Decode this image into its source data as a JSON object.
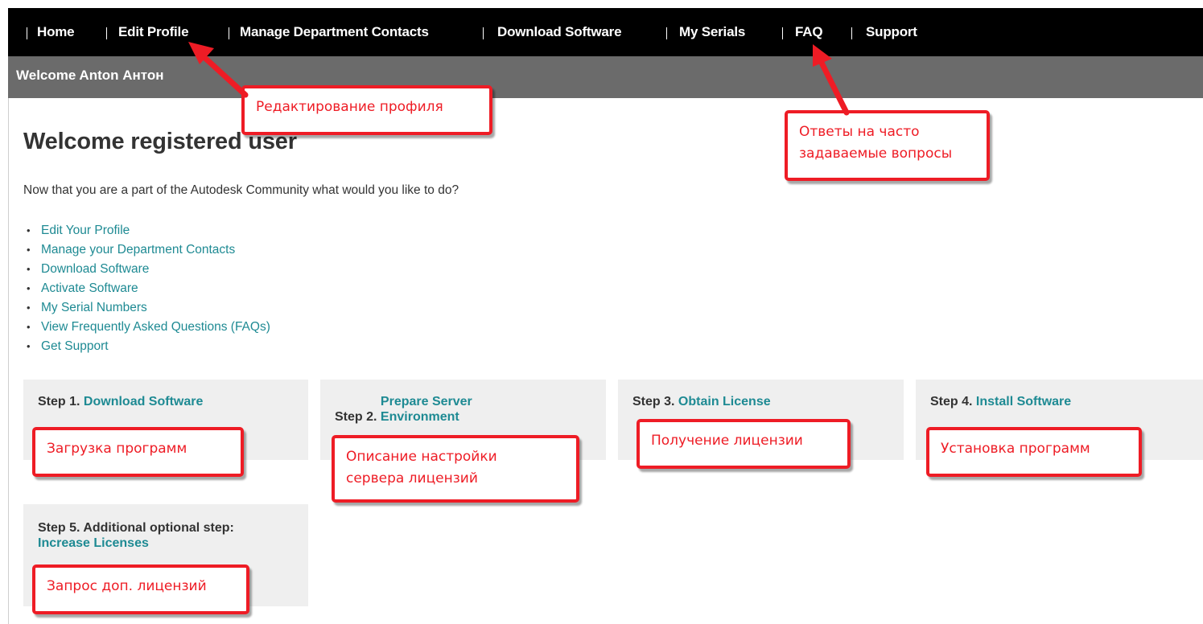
{
  "nav": {
    "items": [
      "Home",
      "Edit Profile",
      "Manage Department Contacts",
      "Download Software",
      "My Serials",
      "FAQ",
      "Support"
    ]
  },
  "welcome_bar": {
    "text": "Welcome Anton Антон"
  },
  "main": {
    "title": "Welcome registered user",
    "intro": "Now that you are a part of the Autodesk Community what would you like to do?",
    "links": [
      "Edit Your Profile",
      "Manage your Department Contacts",
      "Download Software",
      "Activate Software",
      "My Serial Numbers",
      "View Frequently Asked Questions (FAQs)",
      "Get Support"
    ]
  },
  "steps": [
    {
      "label": "Step 1.",
      "link": "Download Software"
    },
    {
      "label": "Step 2.",
      "link": "Prepare Server Environment"
    },
    {
      "label": "Step 3.",
      "link": "Obtain License"
    },
    {
      "label": "Step 4.",
      "link": "Install Software"
    },
    {
      "label": "Step 5. Additional optional step:",
      "link": "Increase Licenses"
    }
  ],
  "annotations": {
    "edit_profile": "Редактирование профиля",
    "faq": [
      "Ответы на часто",
      "задаваемые вопросы"
    ],
    "step1": "Загрузка программ",
    "step2": [
      "Описание настройки",
      "сервера лицензий"
    ],
    "step3": "Получение лицензии",
    "step4": "Установка программ",
    "step5": "Запрос доп. лицензий"
  },
  "colors": {
    "nav_bg": "#000000",
    "welcome_bar_bg": "#6b6b6b",
    "link": "#1e8a93",
    "step_bg": "#efefef",
    "annotation_red": "#ee1c25"
  }
}
